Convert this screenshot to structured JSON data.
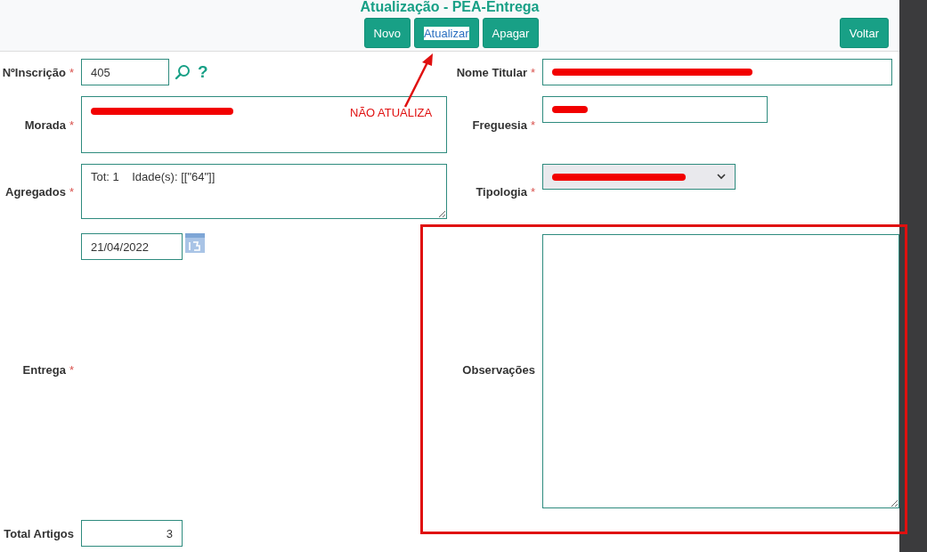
{
  "title": "Atualização - PEA-Entrega",
  "toolbar": {
    "buttons": [
      {
        "label": "Novo",
        "selected": false
      },
      {
        "label": "Atualizar",
        "selected": true
      },
      {
        "label": "Apagar",
        "selected": false
      }
    ],
    "back": "Voltar"
  },
  "rows": [
    {
      "left": {
        "label": "NºInscrição",
        "mark": "*",
        "kind": "lookup",
        "value": "405",
        "help": "?"
      },
      "right": {
        "label": "Nome Titular",
        "mark": "*",
        "kind": "text",
        "redacted": true
      }
    },
    {
      "left": {
        "label": "Morada",
        "mark": "*",
        "kind": "textarea",
        "redacted": true
      },
      "right": {
        "label": "Freguesia",
        "mark": "*",
        "kind": "text",
        "redacted": true
      }
    },
    {
      "left": {
        "label": "Agregados",
        "mark": "*",
        "kind": "textarea",
        "value": "Tot: 1    Idade(s): [[\"64\"]]"
      },
      "right": {
        "label": "Tipologia",
        "mark": "*",
        "kind": "select",
        "redacted": true
      }
    },
    {
      "left": {
        "label": "Entrega",
        "mark": "*",
        "kind": "date",
        "value": "21/04/2022"
      },
      "right": {
        "label": "Observações",
        "kind": "textarea"
      }
    },
    {
      "left": {
        "label": "Total Artigos",
        "kind": "number",
        "value": "3"
      }
    }
  ],
  "annotation": {
    "note": "NÃO ATUALIZA"
  }
}
